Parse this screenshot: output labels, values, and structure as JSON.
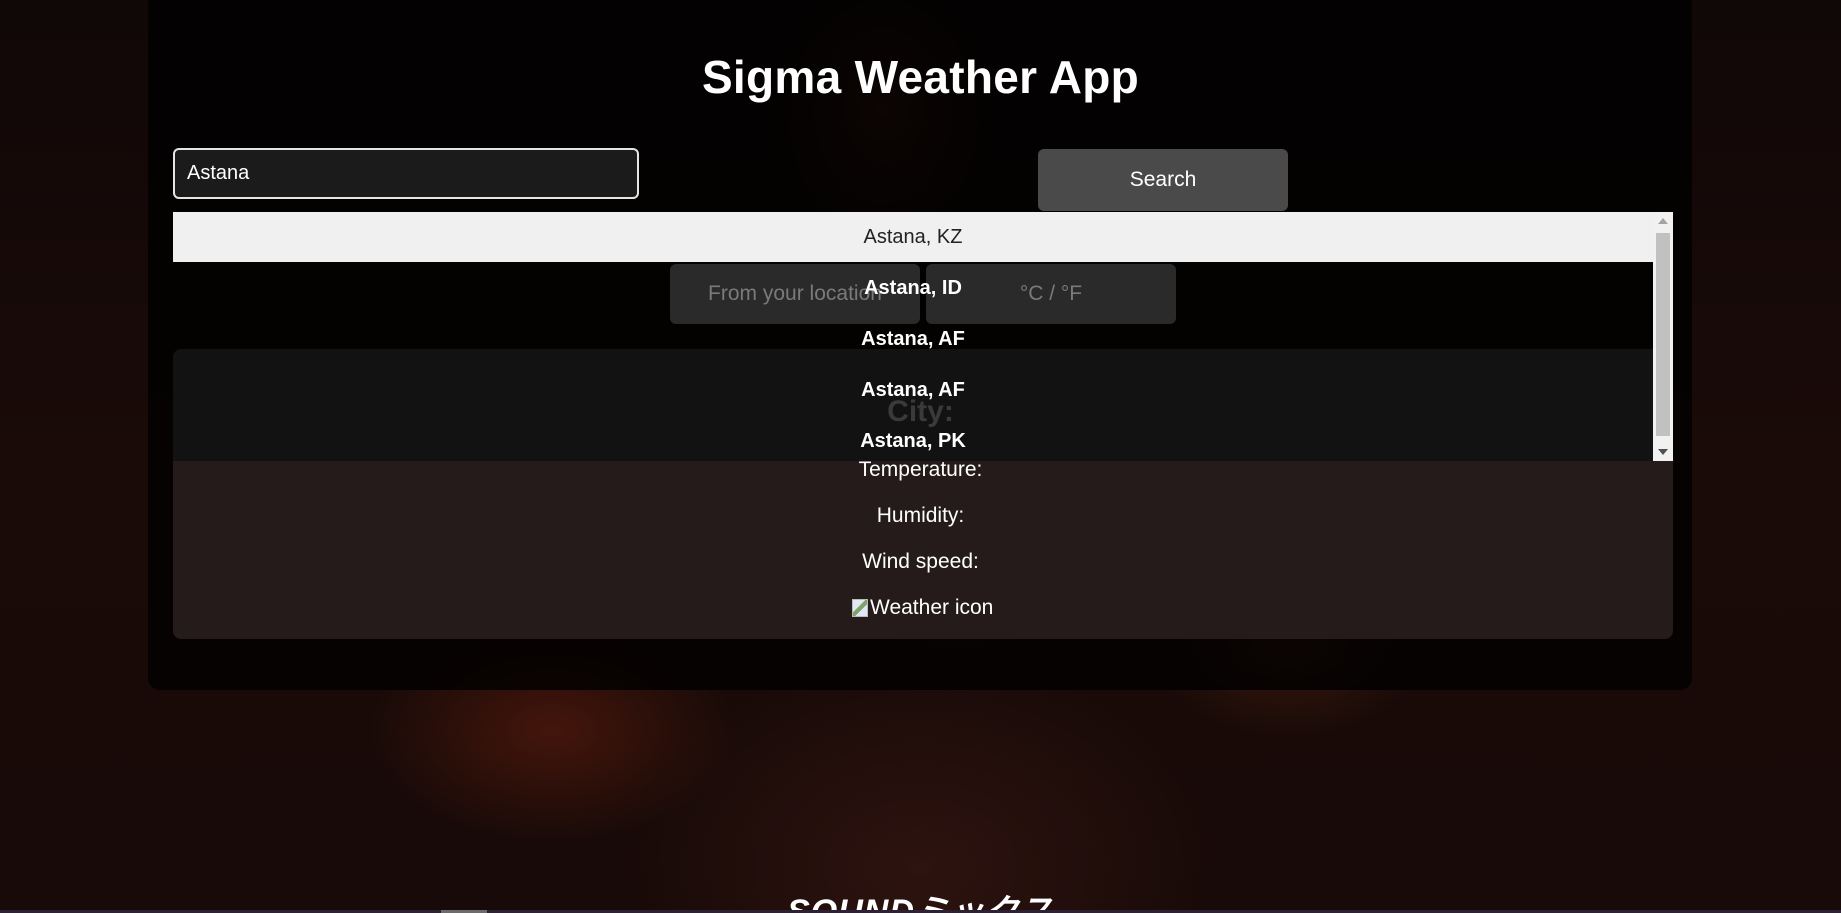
{
  "app": {
    "title": "Sigma Weather App"
  },
  "search": {
    "value": "Astana",
    "button_label": "Search"
  },
  "controls": {
    "location_label": "From your location",
    "unit_toggle_label": "°C / °F"
  },
  "suggestions": [
    {
      "label": "Astana, KZ"
    },
    {
      "label": "Astana, ID"
    },
    {
      "label": "Astana, AF"
    },
    {
      "label": "Astana, AF"
    },
    {
      "label": "Astana, PK"
    }
  ],
  "weather": {
    "city_label": "City:",
    "temperature_label": "Temperature:",
    "humidity_label": "Humidity:",
    "wind_label": "Wind speed:",
    "icon_alt": "Weather icon"
  },
  "footer": {
    "brand": "SOUNDミックス"
  }
}
